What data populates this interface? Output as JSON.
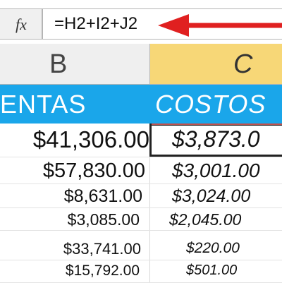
{
  "formula_bar": {
    "fx_label": "fx",
    "formula": "=H2+I2+J2",
    "arrow_color": "#e02020"
  },
  "columns": {
    "b": {
      "label": "B",
      "selected": false
    },
    "c": {
      "label": "C",
      "selected": true,
      "highlight_color": "#f7d777"
    }
  },
  "header_row": {
    "fill_color": "#1aa6ea",
    "ventas_label": "ENTAS",
    "costos_label": "COSTOS"
  },
  "active_cell": {
    "column": "C",
    "value": "$3,873.0"
  },
  "rows": [
    {
      "ventas": "$41,306.00",
      "costos": "$3,873.0"
    },
    {
      "ventas": "$57,830.00",
      "costos": "$3,001.00"
    },
    {
      "ventas": "$8,631.00",
      "costos": "$3,024.00"
    },
    {
      "ventas": "$3,085.00",
      "costos": "$2,045.00"
    },
    {
      "ventas": "$33,741.00",
      "costos": "$220.00"
    },
    {
      "ventas": "$15,792.00",
      "costos": "$501.00"
    }
  ]
}
